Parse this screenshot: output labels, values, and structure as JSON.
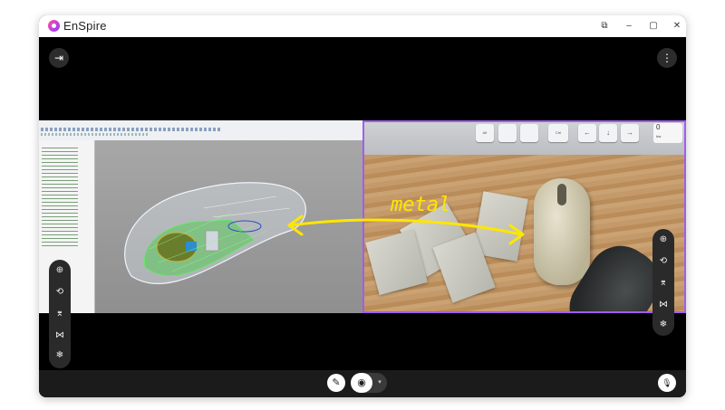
{
  "app": {
    "title": "EnSpire",
    "brand_color": "#a35cf0"
  },
  "window_controls": [
    {
      "name": "pip-icon",
      "glyph": "⧉"
    },
    {
      "name": "minimize-icon",
      "glyph": "–"
    },
    {
      "name": "maximize-icon",
      "glyph": "▢"
    },
    {
      "name": "close-icon",
      "glyph": "✕"
    }
  ],
  "stage": {
    "exit_icon": "⇥",
    "more_icon": "⋮",
    "annotation_text": "metal",
    "annotation_color": "#ffe600",
    "left_tools": [
      "zoom-in",
      "rotate",
      "collapse",
      "expand",
      "freeze"
    ],
    "right_tools": [
      "zoom-in",
      "rotate",
      "collapse",
      "expand",
      "freeze"
    ],
    "tool_glyphs": {
      "zoom-in": "⊕",
      "rotate": "⟲",
      "collapse": "⌆",
      "expand": "⋈",
      "freeze": "❄"
    }
  },
  "keyboard": {
    "keys": [
      "Alt",
      "",
      "",
      "Ctrl",
      "←",
      "↓",
      "→"
    ],
    "big_key": "0",
    "big_key_sub": "Ins"
  },
  "bottombar": {
    "pen_icon": "✎",
    "camera_icon": "◉",
    "caret_icon": "▾",
    "mic_icon": "🎙"
  }
}
